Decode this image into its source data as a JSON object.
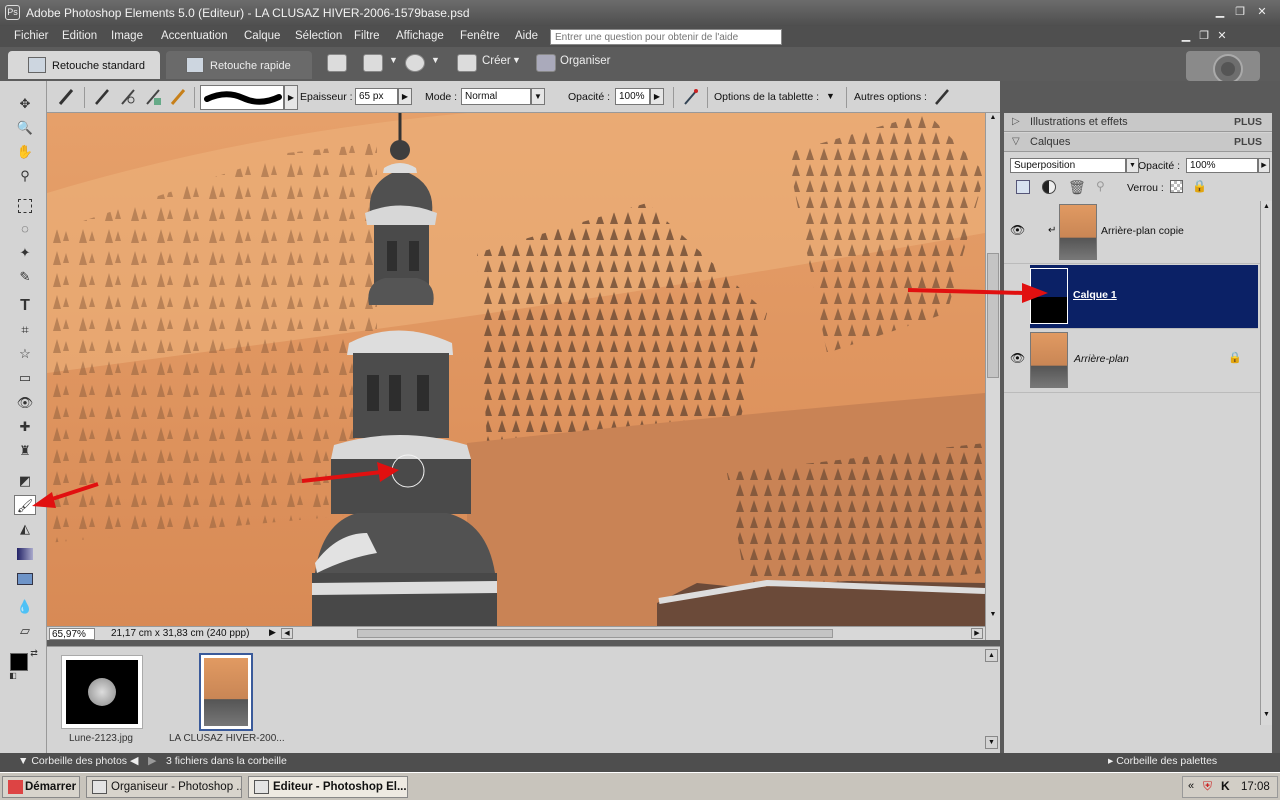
{
  "window": {
    "title": "Adobe Photoshop Elements 5.0 (Editeur) - LA CLUSAZ HIVER-2006-1579base.psd",
    "app_icon": "Ps"
  },
  "menu": {
    "items": [
      "Fichier",
      "Edition",
      "Image",
      "Accentuation",
      "Calque",
      "Sélection",
      "Filtre",
      "Affichage",
      "Fenêtre",
      "Aide"
    ],
    "help_placeholder": "Entrer une question pour obtenir de l'aide"
  },
  "modes": {
    "standard": "Retouche standard",
    "rapide": "Retouche rapide",
    "creer": "Créer",
    "organiser": "Organiser"
  },
  "options": {
    "epaisseur_label": "Epaisseur :",
    "epaisseur_value": "65 px",
    "mode_label": "Mode :",
    "mode_value": "Normal",
    "opacite_label": "Opacité :",
    "opacite_value": "100%",
    "tablette_label": "Options de la tablette :",
    "autres_label": "Autres options :"
  },
  "canvas_status": {
    "zoom": "65,97%",
    "doc_info": "21,17 cm x 31,83 cm (240 ppp)"
  },
  "photo_bin": {
    "items": [
      {
        "label": "Lune-2123.jpg"
      },
      {
        "label": "LA CLUSAZ HIVER-200..."
      }
    ]
  },
  "panels": {
    "illustrations": "Illustrations et effets",
    "calques": "Calques",
    "plus": "PLUS",
    "blend_mode": "Superposition",
    "opacity_label": "Opacité :",
    "opacity_value": "100%",
    "verrou_label": "Verrou :",
    "layers": [
      {
        "name": "Arrière-plan copie",
        "visible": true,
        "selected": false
      },
      {
        "name": "Calque 1",
        "visible": false,
        "selected": true
      },
      {
        "name": "Arrière-plan",
        "visible": true,
        "selected": false
      }
    ]
  },
  "bottom": {
    "corbeille_photos": "Corbeille des photos",
    "fichiers": "3 fichiers dans la corbeille",
    "corbeille_palettes": "Corbeille des palettes"
  },
  "taskbar": {
    "start": "Démarrer",
    "tasks": [
      "Organiseur - Photoshop ...",
      "Editeur - Photoshop El..."
    ],
    "clock": "17:08"
  },
  "colors": {
    "selected_layer": "#0b2166",
    "accent_red": "#e11010"
  }
}
